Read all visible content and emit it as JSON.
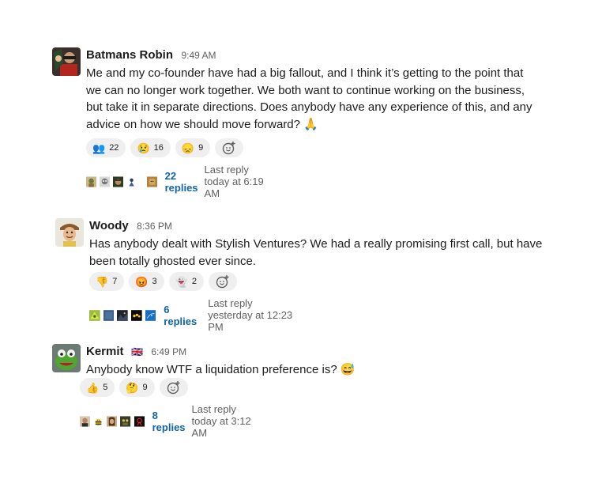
{
  "messages": [
    {
      "author": "Batmans Robin",
      "time": "9:49 AM",
      "lines": [
        "Me and my co-founder have had a big fallout, and I think it’s getting to the point that",
        "we can no longer work together. We both want to continue working on the business,",
        "but take it in separate directions. Does anybody have any experience of this, and any",
        "advice on how we should move forward? 🙏"
      ],
      "reactions": [
        {
          "emoji": "👥",
          "count": "22"
        },
        {
          "emoji": "😢",
          "count": "16"
        },
        {
          "emoji": "😞",
          "count": "9"
        }
      ],
      "thread": {
        "replies": "22 replies",
        "last_reply": "Last reply today at 6:19 AM"
      }
    },
    {
      "author": "Woody",
      "time": "8:36 PM",
      "lines": [
        "Has anybody dealt with Stylish Ventures? We had a really promising first call, but have",
        "been totally ghosted ever since."
      ],
      "reactions": [
        {
          "emoji": "👎",
          "count": "7"
        },
        {
          "emoji": "😡",
          "count": "3"
        },
        {
          "emoji": "👻",
          "count": "2"
        }
      ],
      "thread": {
        "replies": "6 replies",
        "last_reply": "Last reply yesterday at 12:23 PM"
      }
    },
    {
      "author": "Kermit",
      "flag": "🇬🇧",
      "time": "6:49 PM",
      "lines": [
        "Anybody know WTF a liquidation preference is? 😅"
      ],
      "reactions": [
        {
          "emoji": "👍",
          "count": "5"
        },
        {
          "emoji": "🤔",
          "count": "9"
        }
      ],
      "thread": {
        "replies": "8 replies",
        "last_reply": "Last reply today at 3:12 AM"
      }
    }
  ],
  "colors": {
    "text": "#1d1c1d",
    "muted": "#616061",
    "link": "#1264a3",
    "reaction_bg": "#efefef"
  },
  "icons": {
    "add_reaction": "add-reaction-icon"
  }
}
